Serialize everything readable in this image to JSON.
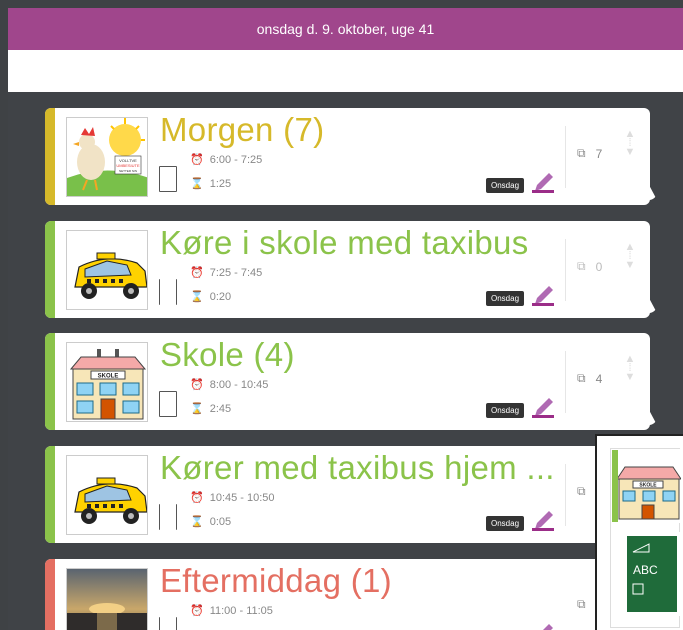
{
  "header": {
    "date_label": "onsdag d. 9. oktober, uge 41"
  },
  "colors": {
    "purple": "#a0468c",
    "yellow": "#d6b92a",
    "green": "#8bc34a",
    "red": "#e46f62"
  },
  "cards": [
    {
      "title": "Morgen (7)",
      "time": "6:00 - 7:25",
      "duration": "1:25",
      "day": "Onsdag",
      "count": "7",
      "image": "rooster-sun-picture"
    },
    {
      "title": "Køre i skole med taxibus",
      "time": "7:25 - 7:45",
      "duration": "0:20",
      "day": "Onsdag",
      "count": "0",
      "image": "taxi-picture"
    },
    {
      "title": "Skole (4)",
      "time": "8:00 - 10:45",
      "duration": "2:45",
      "day": "Onsdag",
      "count": "4",
      "image": "school-picture"
    },
    {
      "title": "Kører med taxibus hjem ...",
      "time": "10:45 - 10:50",
      "duration": "0:05",
      "day": "Onsdag",
      "count": "",
      "image": "taxi-picture"
    },
    {
      "title": "Eftermiddag (1)",
      "time": "11:00 - 11:05",
      "duration": "",
      "day": "",
      "count": "",
      "image": "sunset-picture"
    }
  ],
  "popup": {
    "school_sign": "SKOLE",
    "board_text": "ABC"
  }
}
